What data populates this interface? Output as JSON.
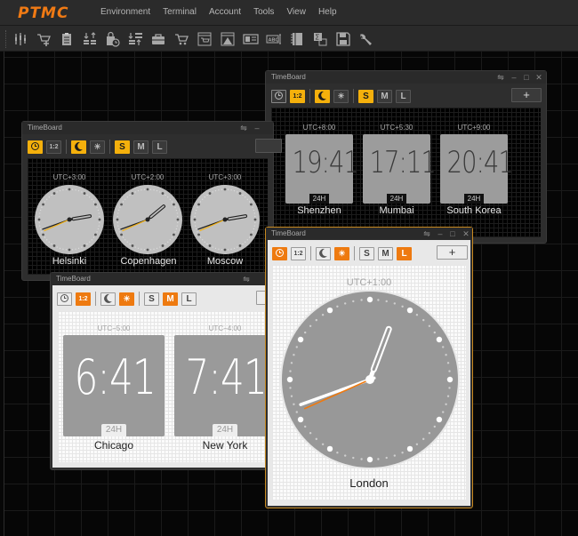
{
  "app": {
    "logo": "PTMC",
    "menu": [
      "Environment",
      "Terminal",
      "Account",
      "Tools",
      "View",
      "Help"
    ],
    "toolbar_icons": [
      "chart-candles-icon",
      "add-order-icon",
      "clipboard-icon",
      "order-book-icon",
      "bag-clock-icon",
      "sort-icon",
      "briefcase-icon",
      "cart-icon",
      "panel-cart-icon",
      "panel-alert-icon",
      "id-card-icon",
      "abc-input-icon",
      "notebook-icon",
      "sigma-report-icon",
      "save-icon",
      "wrench-icon"
    ]
  },
  "windows": [
    {
      "id": "tb-dark-digital",
      "title": "TimeBoard",
      "theme": "dark",
      "mode": "digital",
      "size": "S",
      "toolbar": {
        "clock": "clock-mode",
        "digital": "1:2",
        "night": "moon",
        "day": "sun",
        "sizes": [
          "S",
          "M",
          "L"
        ],
        "add": "+"
      },
      "clocks": [
        {
          "utc": "UTC+8:00",
          "time": "19:41",
          "format": "24H",
          "city": "Shenzhen"
        },
        {
          "utc": "UTC+5:30",
          "time": "17:11",
          "format": "24H",
          "city": "Mumbai"
        },
        {
          "utc": "UTC+9:00",
          "time": "20:41",
          "format": "24H",
          "city": "South Korea"
        }
      ]
    },
    {
      "id": "tb-dark-analog",
      "title": "TimeBoard",
      "theme": "dark",
      "mode": "analog",
      "size": "S",
      "toolbar": {
        "digital": "1:2",
        "sizes": [
          "S",
          "M",
          "L"
        ]
      },
      "clocks": [
        {
          "utc": "UTC+3:00",
          "city": "Helsinki",
          "hour": 2,
          "minute": 41,
          "second": 41
        },
        {
          "utc": "UTC+2:00",
          "city": "Copenhagen",
          "hour": 1,
          "minute": 41,
          "second": 41
        },
        {
          "utc": "UTC+3:00",
          "city": "Moscow",
          "hour": 2,
          "minute": 41,
          "second": 41
        }
      ]
    },
    {
      "id": "tb-light-digital",
      "title": "TimeBoard",
      "theme": "light",
      "mode": "digital",
      "size": "M",
      "toolbar": {
        "digital": "1:2",
        "sizes": [
          "S",
          "M",
          "L"
        ]
      },
      "clocks": [
        {
          "utc": "UTC−5:00",
          "time": "6:41",
          "format": "24H",
          "city": "Chicago"
        },
        {
          "utc": "UTC−4:00",
          "time": "7:41",
          "format": "24H",
          "city": "New York"
        }
      ]
    },
    {
      "id": "tb-light-analog",
      "title": "TimeBoard",
      "theme": "light",
      "mode": "analog",
      "size": "L",
      "toolbar": {
        "digital": "1:2",
        "sizes": [
          "S",
          "M",
          "L"
        ],
        "add": "+"
      },
      "clocks": [
        {
          "utc": "UTC+1:00",
          "city": "London",
          "hour": 12,
          "minute": 41,
          "second": 41
        }
      ]
    }
  ],
  "colors": {
    "brand": "#f07a14",
    "accent_yellow": "#f4b00c",
    "accent_orange": "#ee7a10",
    "active_border": "#c8891f"
  }
}
